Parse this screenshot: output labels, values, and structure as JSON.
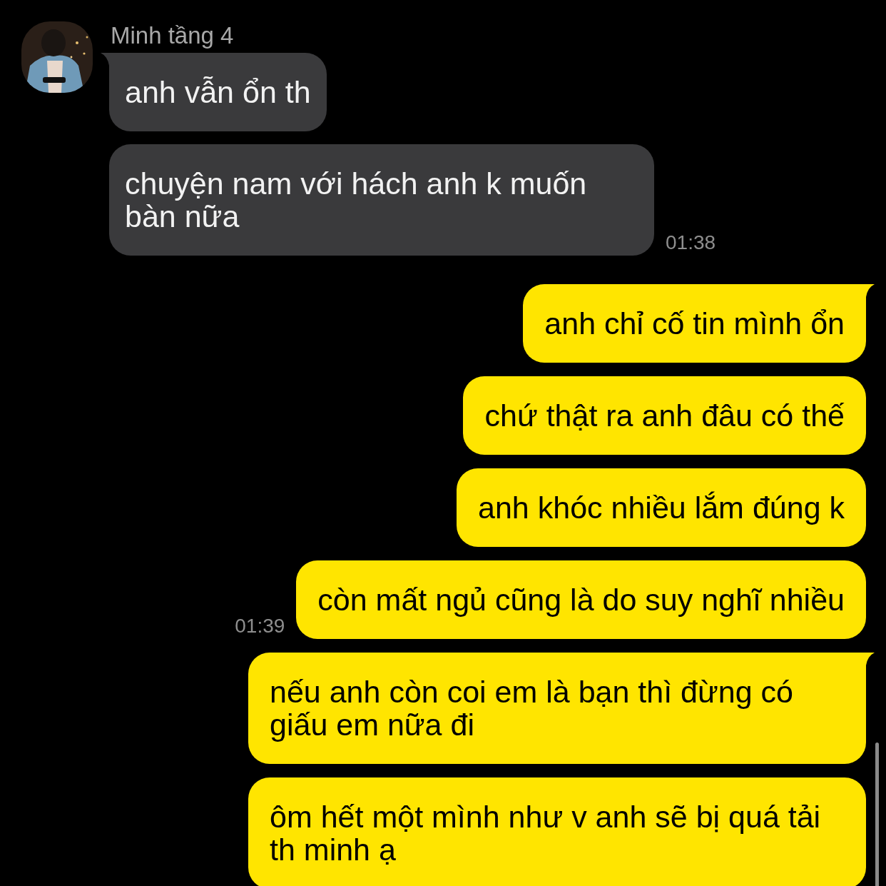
{
  "contact": {
    "name": "Minh tầng 4"
  },
  "messages": [
    {
      "kind": "incoming",
      "text": "anh vẫn ổn th",
      "tail": true
    },
    {
      "kind": "incoming",
      "text": "chuyện nam với hách anh k muốn bàn nữa",
      "tail": false,
      "time": "01:38"
    },
    {
      "kind": "outgoing",
      "text": "anh chỉ cố tin mình ổn",
      "tail": true
    },
    {
      "kind": "outgoing",
      "text": "chứ thật ra anh đâu có thế",
      "tail": false
    },
    {
      "kind": "outgoing",
      "text": "anh khóc nhiều lắm đúng k",
      "tail": false
    },
    {
      "kind": "outgoing",
      "text": "còn mất ngủ cũng là do suy nghĩ nhiều",
      "tail": false,
      "time": "01:39"
    },
    {
      "kind": "outgoing",
      "text": "nếu anh còn coi em là bạn thì đừng có giấu em nữa đi",
      "tail": true
    },
    {
      "kind": "outgoing",
      "text": "ôm hết một mình như v anh sẽ bị quá tải th minh ạ",
      "tail": false
    }
  ]
}
